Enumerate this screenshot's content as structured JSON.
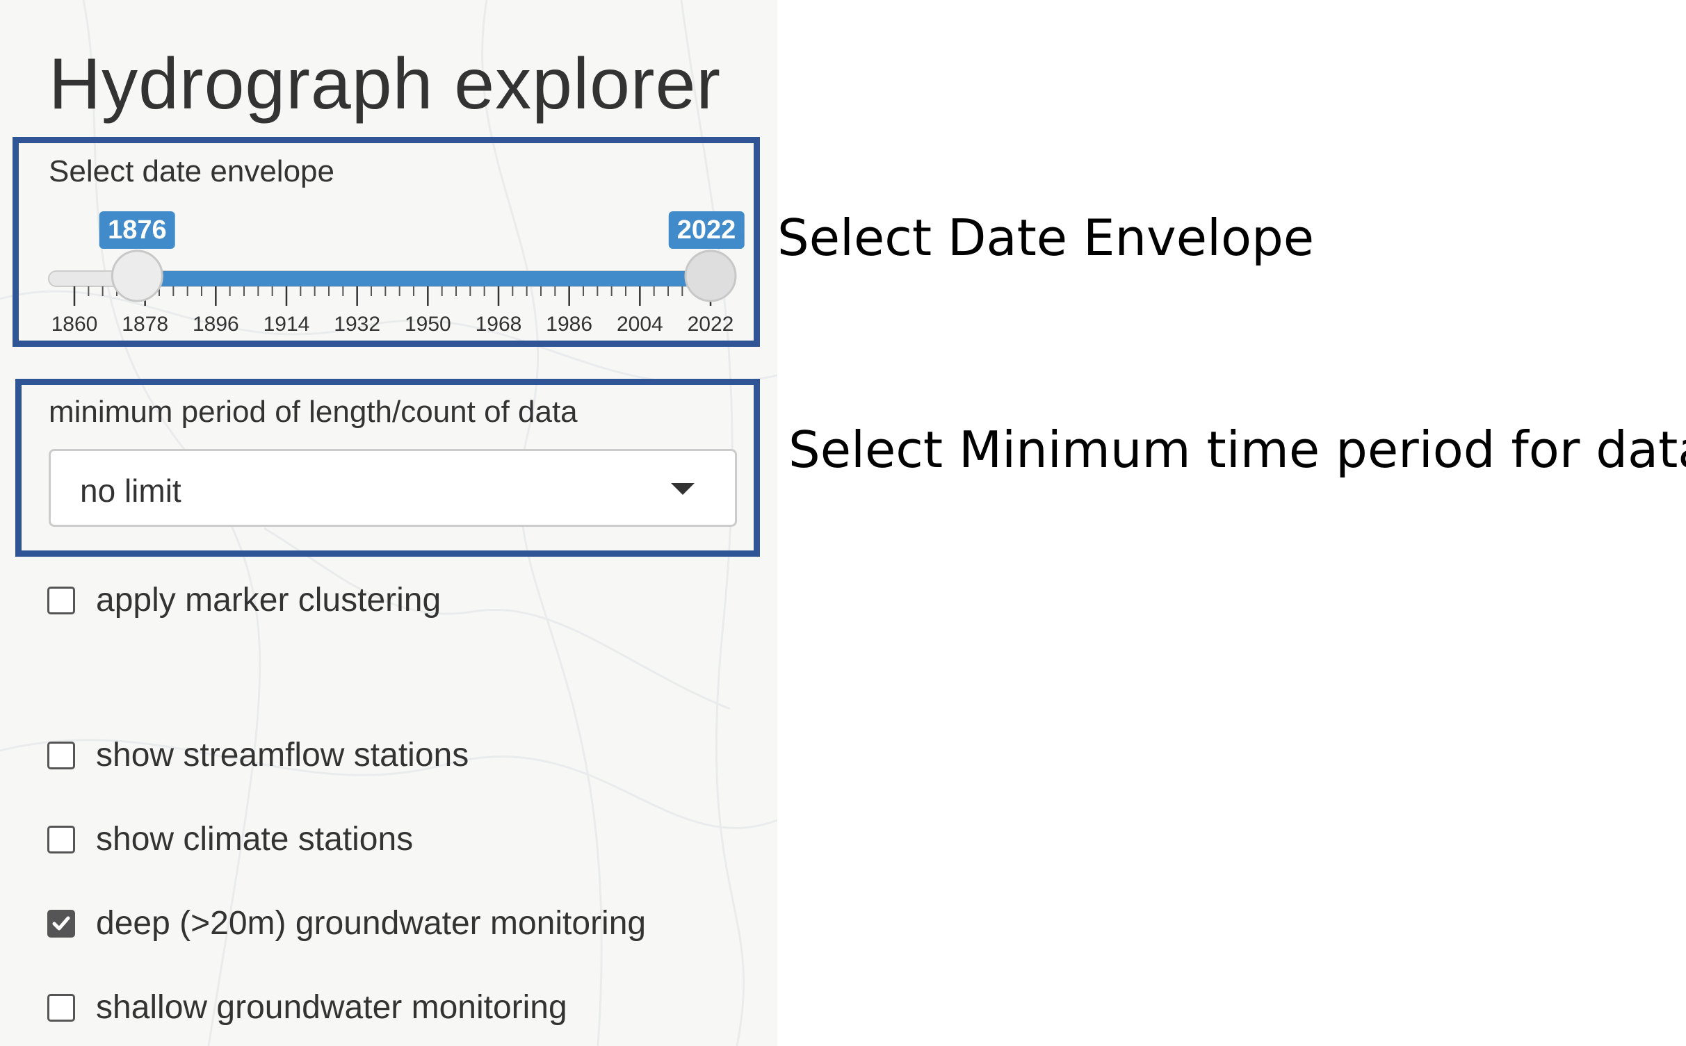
{
  "sidebar": {
    "title": "Hydrograph explorer",
    "date_envelope": {
      "label": "Select date envelope",
      "min": 1860,
      "max": 2022,
      "from": 1876,
      "to": 2022,
      "from_label": "1876",
      "to_label": "2022",
      "ticks": [
        "1860",
        "1878",
        "1896",
        "1914",
        "1932",
        "1950",
        "1968",
        "1986",
        "2004",
        "2022"
      ],
      "color": "#428bca"
    },
    "min_period": {
      "label": "minimum period of length/count of data",
      "value": "no limit"
    },
    "checkboxes": [
      {
        "label": "apply marker clustering",
        "checked": false
      },
      {
        "label": "show streamflow stations",
        "checked": false
      },
      {
        "label": "show climate stations",
        "checked": false
      },
      {
        "label": "deep (>20m) groundwater monitoring",
        "checked": true
      },
      {
        "label": "shallow groundwater monitoring",
        "checked": false
      }
    ]
  },
  "annotations": {
    "date_envelope": "Select Date Envelope",
    "min_period": "Select Minimum time period for data",
    "box_color": "#2f5597"
  }
}
